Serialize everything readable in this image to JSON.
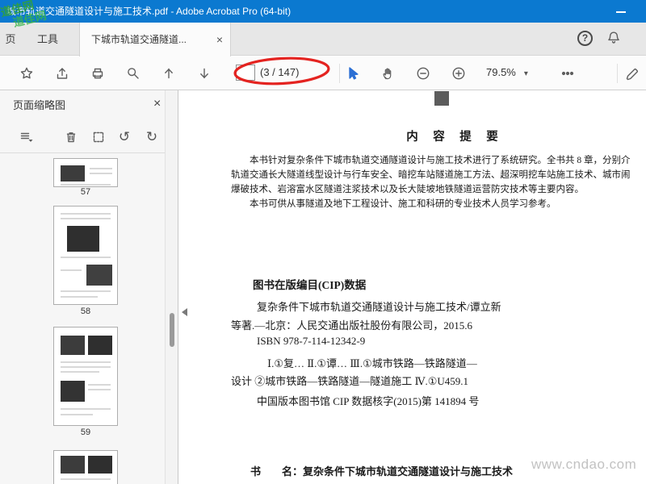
{
  "window": {
    "title": "城市轨道交通隧道设计与施工技术.pdf - Adobe Acrobat Pro (64-bit)"
  },
  "watermarks": {
    "top_line1": "道佳网",
    "top_line2": "道佳网",
    "bottom": "www.cndao.com"
  },
  "tab_bar": {
    "home": "页",
    "tools": "工具",
    "document": "下城市轨道交通隧道..."
  },
  "icons": {
    "close": "×",
    "help": "?",
    "rotate_ccw": "↺",
    "rotate_cw": "↻",
    "caret_down": "▾"
  },
  "toolbar": {
    "page_indicator": "(3 / 147)",
    "zoom_level": "79.5%"
  },
  "thumbnails_panel": {
    "title": "页面缩略图",
    "page_labels": [
      "57",
      "58",
      "59"
    ]
  },
  "document_page": {
    "heading": "内　容　提　要",
    "paragraph_lines": [
      "本书针对复杂条件下城市轨道交通隧道设计与施工技术进行了系统研究。全书共 8 章，分别介",
      "轨道交通长大隧道线型设计与行车安全、暗挖车站隧道施工方法、超深明挖车站施工技术、城市闹",
      "爆破技术、岩溶富水区隧道注浆技术以及长大陡坡地铁隧道运营防灾技术等主要内容。",
      "本书可供从事隧道及地下工程设计、施工和科研的专业技术人员学习参考。"
    ],
    "cip_heading": "图书在版编目(CIP)数据",
    "cip_lines": [
      "复杂条件下城市轨道交通隧道设计与施工技术/谭立新",
      "等著.—北京：人民交通出版社股份有限公司，2015.6",
      "ISBN 978-7-114-12342-9",
      "Ⅰ.①复… Ⅱ.①谭… Ⅲ.①城市铁路—铁路隧道—",
      "设计 ②城市铁路—铁路隧道—隧道施工 Ⅳ.①U459.1",
      "中国版本图书馆 CIP 数据核字(2015)第 141894 号"
    ],
    "footer_line": "书　　名：复杂条件下城市轨道交通隧道设计与施工技术"
  },
  "colors": {
    "title_bar": "#0b79d0",
    "annotation_red": "#e42320",
    "watermark_green": "#2f9e44"
  }
}
